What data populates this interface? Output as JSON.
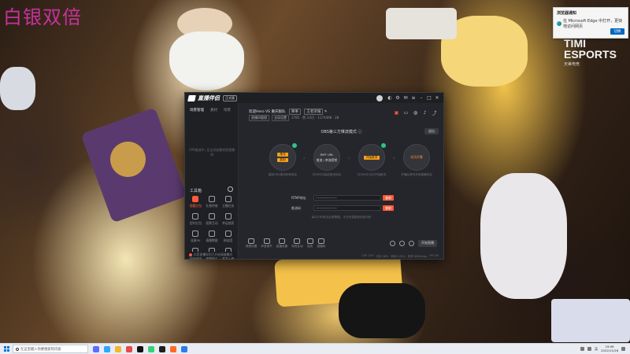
{
  "overlay": {
    "watermark": "白银双倍",
    "brand_logo": "TIMI",
    "brand_logo_sub": "ESPORTS",
    "brand_sub": "天美电竞"
  },
  "toast": {
    "title": "浏览器通知",
    "body": "在 Microsoft Edge 中打开，更快地访问网页",
    "button": "切换"
  },
  "app": {
    "name": "直播伴侣",
    "version": "正式版",
    "titlebar_icons": [
      "user-avatar-icon",
      "skin-icon",
      "settings-icon",
      "message-icon",
      "menu-icon",
      "minimize-icon",
      "maximize-icon",
      "close-icon"
    ],
    "sidebar": {
      "tabs": [
        "场景管理",
        "素材",
        "场景"
      ],
      "active_tab": 0,
      "empty_text": "CPS推流中, 无法添加素材到直播间",
      "tools_title": "工具箱",
      "tools": [
        {
          "label": "观看红包",
          "hot": true
        },
        {
          "label": "礼物特效",
          "hot": false
        },
        {
          "label": "主播任务",
          "hot": false
        },
        {
          "label": "定时红包",
          "hot": false
        },
        {
          "label": "投票互动",
          "hot": false
        },
        {
          "label": "幸运抽奖",
          "hot": false
        },
        {
          "label": "连麦PK",
          "hot": false
        },
        {
          "label": "直播数据",
          "hot": false
        },
        {
          "label": "粉丝团",
          "hot": false
        },
        {
          "label": "视频连线",
          "hot": false
        },
        {
          "label": "弹幕助手",
          "hot": false
        },
        {
          "label": "更多工具",
          "hot": false
        }
      ],
      "footer": "抖音直播伴侣已开启高能模式"
    },
    "main": {
      "live_title": "欢迎Hero VS 重庆狼队",
      "live_tag": "赛事",
      "live_pill": "王者荣耀",
      "meta": [
        "直播间管理",
        "全局设置"
      ],
      "stats": "1785  ·  赞 3.8万  ·  1174498  ·  28",
      "mode_title": "OBS第三方推流模式",
      "exit_label": "退出",
      "steps": [
        {
          "pills": [
            "推流",
            "复制"
          ],
          "text": "",
          "link": "",
          "caption": "复制OBS推流码和地址"
        },
        {
          "pills": [],
          "text": "RMT URL",
          "link": "推流 / 串流密钥",
          "caption": "在OBS中粘贴推流地址"
        },
        {
          "pills": [
            "开始推流"
          ],
          "text": "",
          "link": "",
          "caption": "在OBS中点击开始推流"
        },
        {
          "pills": [],
          "text": "",
          "link": "成功开播",
          "caption": "开播后请勿关闭直播伴侣"
        }
      ],
      "fields": [
        {
          "label": "RTMP地址",
          "value": "••••••••••••",
          "action": "复制"
        },
        {
          "label": "推流码",
          "value": "••••••••••••",
          "action": "复制"
        }
      ],
      "notice": "每次OBS推流后都需要，不允许重复使用推流码",
      "bottom_tools": [
        "美颜设置",
        "声音调节",
        "直播设置",
        "特效互动",
        "连线",
        "直播间"
      ],
      "start_label": "开始直播",
      "status": [
        "CPU 12%",
        "内存 38%",
        "丢帧 0.00%",
        "码率 6000kbps",
        "FPS 60"
      ]
    }
  },
  "taskbar": {
    "search_placeholder": "在这里输入你要搜索的内容",
    "tray_text": "英",
    "time": "19:06",
    "date": "2022/11/26"
  }
}
